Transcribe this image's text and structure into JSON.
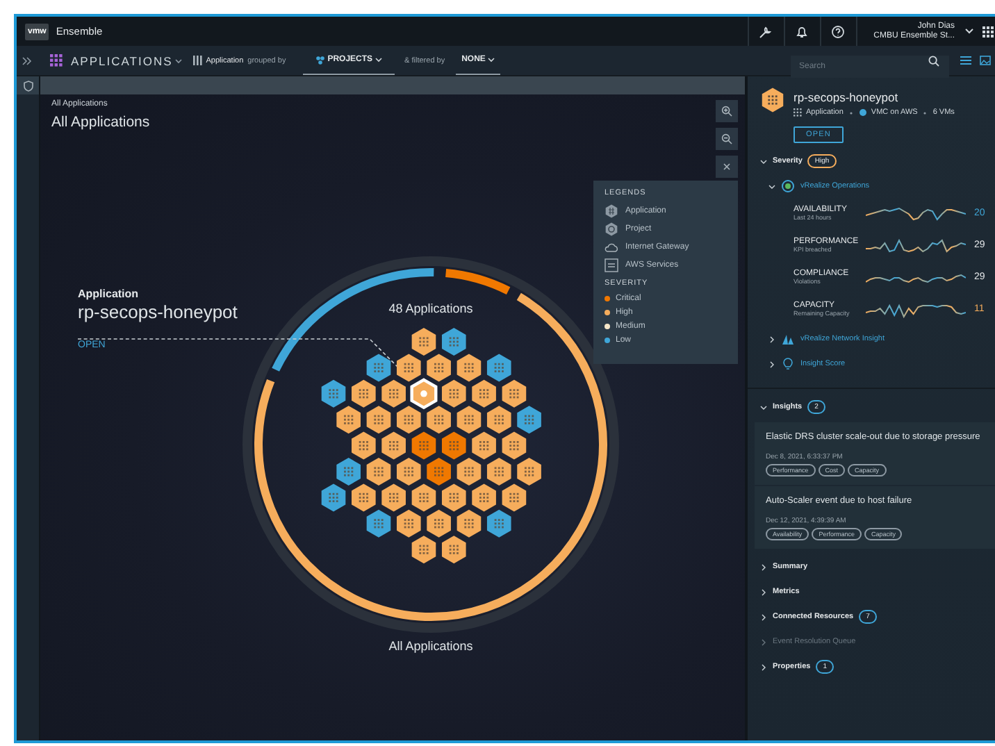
{
  "header": {
    "logo": "vmw",
    "product": "Ensemble",
    "user_name": "John Dias",
    "user_org": "CMBU Ensemble St..."
  },
  "toolbar": {
    "section": "APPLICATIONS",
    "group_label": "Application",
    "grouped_by": "grouped by",
    "group_value": "PROJECTS",
    "filtered_by": "& filtered by",
    "filter_value": "NONE",
    "search": {
      "placeholder": "Search"
    }
  },
  "canvas": {
    "breadcrumb": "All Applications",
    "title": "All Applications",
    "count_label": "48 Applications",
    "footer_label": "All Applications",
    "selection": {
      "type_label": "Application",
      "name": "rp-secops-honeypot",
      "action": "OPEN"
    }
  },
  "hex_rows": [
    [
      {
        "color": "#f6ad5c",
        "selected": false
      },
      {
        "color": "#3fa6d8",
        "selected": false
      }
    ],
    [
      {
        "color": "#3fa6d8",
        "selected": false
      },
      {
        "color": "#f6ad5c",
        "selected": false
      },
      {
        "color": "#f6ad5c",
        "selected": false
      },
      {
        "color": "#f6ad5c",
        "selected": false
      },
      {
        "color": "#3fa6d8",
        "selected": false
      }
    ],
    [
      {
        "color": "#3fa6d8",
        "selected": false
      },
      {
        "color": "#f6ad5c",
        "selected": false
      },
      {
        "color": "#f6ad5c",
        "selected": false
      },
      {
        "color": "#f6ad5c",
        "selected": true
      },
      {
        "color": "#f6ad5c",
        "selected": false
      },
      {
        "color": "#f6ad5c",
        "selected": false
      },
      {
        "color": "#f6ad5c",
        "selected": false
      }
    ],
    [
      {
        "color": "#f6ad5c",
        "selected": false
      },
      {
        "color": "#f6ad5c",
        "selected": false
      },
      {
        "color": "#f6ad5c",
        "selected": false
      },
      {
        "color": "#f6ad5c",
        "selected": false
      },
      {
        "color": "#f6ad5c",
        "selected": false
      },
      {
        "color": "#f6ad5c",
        "selected": false
      },
      {
        "color": "#3fa6d8",
        "selected": false
      }
    ],
    [
      {
        "color": "#f6ad5c",
        "selected": false
      },
      {
        "color": "#f6ad5c",
        "selected": false
      },
      {
        "color": "#f07800",
        "selected": false
      },
      {
        "color": "#f07800",
        "selected": false
      },
      {
        "color": "#f6ad5c",
        "selected": false
      },
      {
        "color": "#f6ad5c",
        "selected": false
      }
    ],
    [
      {
        "color": "#3fa6d8",
        "selected": false
      },
      {
        "color": "#f6ad5c",
        "selected": false
      },
      {
        "color": "#f6ad5c",
        "selected": false
      },
      {
        "color": "#f07800",
        "selected": false
      },
      {
        "color": "#f6ad5c",
        "selected": false
      },
      {
        "color": "#f6ad5c",
        "selected": false
      },
      {
        "color": "#f6ad5c",
        "selected": false
      }
    ],
    [
      {
        "color": "#3fa6d8",
        "selected": false
      },
      {
        "color": "#f6ad5c",
        "selected": false
      },
      {
        "color": "#f6ad5c",
        "selected": false
      },
      {
        "color": "#f6ad5c",
        "selected": false
      },
      {
        "color": "#f6ad5c",
        "selected": false
      },
      {
        "color": "#f6ad5c",
        "selected": false
      },
      {
        "color": "#f6ad5c",
        "selected": false
      }
    ],
    [
      {
        "color": "#3fa6d8",
        "selected": false
      },
      {
        "color": "#f6ad5c",
        "selected": false
      },
      {
        "color": "#f6ad5c",
        "selected": false
      },
      {
        "color": "#f6ad5c",
        "selected": false
      },
      {
        "color": "#3fa6d8",
        "selected": false
      }
    ],
    [
      {
        "color": "#f6ad5c",
        "selected": false
      },
      {
        "color": "#f6ad5c",
        "selected": false
      }
    ]
  ],
  "legend": {
    "title": "LEGENDS",
    "items": [
      {
        "kind": "application",
        "label": "Application"
      },
      {
        "kind": "project",
        "label": "Project"
      },
      {
        "kind": "gateway",
        "label": "Internet Gateway"
      },
      {
        "kind": "aws",
        "label": "AWS Services"
      }
    ],
    "severity_title": "SEVERITY",
    "severities": [
      {
        "color": "#f07800",
        "label": "Critical"
      },
      {
        "color": "#f6ad5c",
        "label": "High"
      },
      {
        "color": "#f5e6c8",
        "label": "Medium"
      },
      {
        "color": "#3fa6d8",
        "label": "Low"
      }
    ]
  },
  "details": {
    "name": "rp-secops-honeypot",
    "type": "Application",
    "location": "VMC on AWS",
    "vms": "6 VMs",
    "open": "OPEN",
    "severity": {
      "label": "Severity",
      "value": "High",
      "color": "#f6ad5c",
      "expanded": true
    },
    "sources": [
      {
        "kind": "operations",
        "name": "vRealize Operations",
        "expanded": true,
        "metrics": [
          {
            "name": "AVAILABILITY",
            "caption": "Last 24 hours",
            "value": "20",
            "color": "#3fa6d8"
          },
          {
            "name": "PERFORMANCE",
            "caption": "KPI breached",
            "value": "29",
            "color": "#e6e9eb"
          },
          {
            "name": "COMPLIANCE",
            "caption": "Violations",
            "value": "29",
            "color": "#e6e9eb"
          },
          {
            "name": "CAPACITY",
            "caption": "Remaining Capacity",
            "value": "11",
            "color": "#f6ad5c"
          }
        ]
      },
      {
        "kind": "network",
        "name": "vRealize Network Insight",
        "expanded": false
      },
      {
        "kind": "score",
        "name": "Insight Score",
        "expanded": false
      }
    ],
    "insights": {
      "label": "Insights",
      "count": "2",
      "expanded": true,
      "items": [
        {
          "title": "Elastic DRS cluster scale-out due to storage pressure",
          "time": "Dec 8, 2021, 6:33:37 PM",
          "tags": [
            "Performance",
            "Cost",
            "Capacity"
          ]
        },
        {
          "title": "Auto-Scaler event due to host failure",
          "time": "Dec 12, 2021, 4:39:39 AM",
          "tags": [
            "Availability",
            "Performance",
            "Capacity"
          ]
        }
      ]
    },
    "sections": [
      {
        "label": "Summary",
        "disabled": false
      },
      {
        "label": "Metrics",
        "disabled": false
      },
      {
        "label": "Connected Resources",
        "count": "7",
        "disabled": false
      },
      {
        "label": "Event Resolution Queue",
        "disabled": true
      },
      {
        "label": "Properties",
        "count": "1",
        "disabled": false
      }
    ]
  }
}
